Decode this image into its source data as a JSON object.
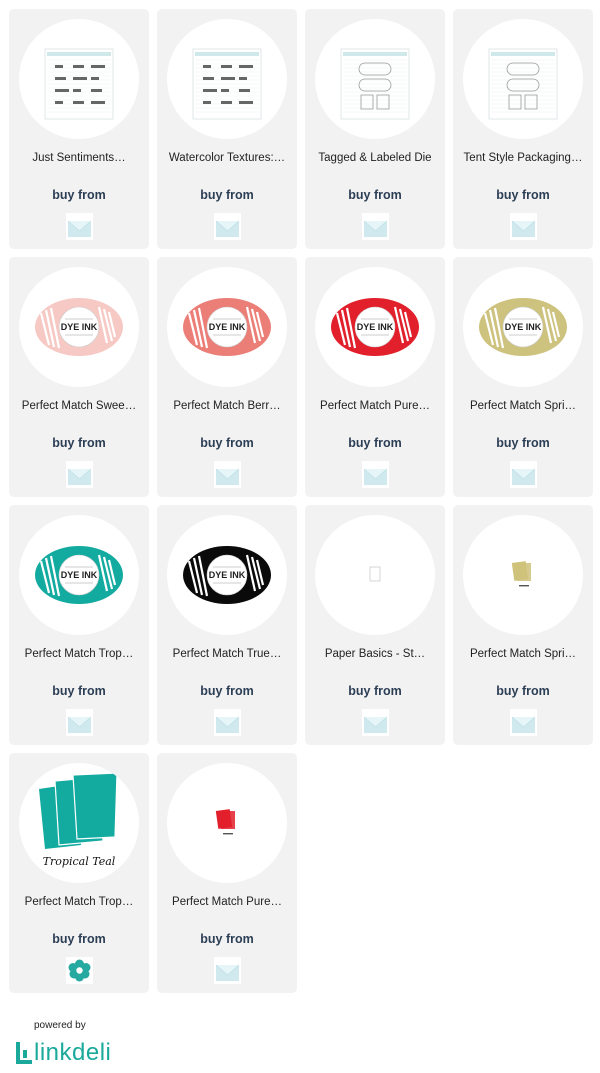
{
  "cards": [
    {
      "title": "Just Sentiments…",
      "buy_label": "buy from",
      "image": "stamp-set-sheet",
      "store_icon": "envelope-store-icon"
    },
    {
      "title": "Watercolor Textures:…",
      "buy_label": "buy from",
      "image": "stamp-set-sheet",
      "store_icon": "envelope-store-icon"
    },
    {
      "title": "Tagged & Labeled Die",
      "buy_label": "buy from",
      "image": "die-set-sheet",
      "store_icon": "envelope-store-icon"
    },
    {
      "title": "Tent Style Packaging…",
      "buy_label": "buy from",
      "image": "die-set-sheet",
      "store_icon": "envelope-store-icon"
    },
    {
      "title": "Perfect Match Swee…",
      "buy_label": "buy from",
      "image": "dye-ink-pad",
      "color": "#f6c9c4",
      "store_icon": "envelope-store-icon"
    },
    {
      "title": "Perfect Match Berr…",
      "buy_label": "buy from",
      "image": "dye-ink-pad",
      "color": "#ec7e78",
      "store_icon": "envelope-store-icon"
    },
    {
      "title": "Perfect Match Pure…",
      "buy_label": "buy from",
      "image": "dye-ink-pad",
      "color": "#e2202c",
      "store_icon": "envelope-store-icon"
    },
    {
      "title": "Perfect Match Spri…",
      "buy_label": "buy from",
      "image": "dye-ink-pad",
      "color": "#cdc27e",
      "store_icon": "envelope-store-icon"
    },
    {
      "title": "Perfect Match Trop…",
      "buy_label": "buy from",
      "image": "dye-ink-pad",
      "color": "#13aba0",
      "store_icon": "envelope-store-icon"
    },
    {
      "title": "Perfect Match True…",
      "buy_label": "buy from",
      "image": "dye-ink-pad",
      "color": "#0a0a0a",
      "store_icon": "envelope-store-icon"
    },
    {
      "title": "Paper Basics - St…",
      "buy_label": "buy from",
      "image": "blank-paper",
      "store_icon": "envelope-store-icon"
    },
    {
      "title": "Perfect Match Spri…",
      "buy_label": "buy from",
      "image": "small-cardstock",
      "color": "#cfc27a",
      "store_icon": "envelope-store-icon"
    },
    {
      "title": "Perfect Match Trop…",
      "buy_label": "buy from",
      "image": "large-cardstock",
      "color": "#13aba0",
      "swatch_label": "Tropical Teal",
      "store_icon": "flower-store-icon"
    },
    {
      "title": "Perfect Match Pure…",
      "buy_label": "buy from",
      "image": "small-cardstock",
      "color": "#e2202c",
      "store_icon": "envelope-store-icon"
    }
  ],
  "footer": {
    "powered_by": "powered by",
    "logo": "linkdeli"
  },
  "colors": {
    "card_bg": "#f2f2f2",
    "buy_text": "#2c3e55",
    "brand_teal": "#1aa99b",
    "envelope": "#cfe9ee"
  }
}
